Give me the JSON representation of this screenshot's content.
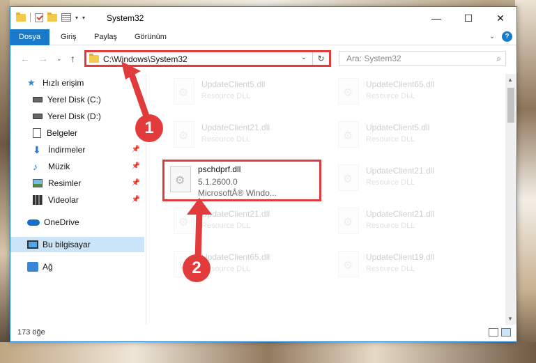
{
  "window": {
    "title": "System32"
  },
  "ribbon": {
    "tabs": [
      "Dosya",
      "Giriş",
      "Paylaş",
      "Görünüm"
    ],
    "help": "?"
  },
  "navigation": {
    "address": "C:\\Windows\\System32",
    "search_placeholder": "Ara: System32"
  },
  "sidebar": {
    "items": [
      {
        "label": "Hızlı erişim",
        "icon": "star-icon"
      },
      {
        "label": "Yerel Disk (C:)",
        "icon": "disk-icon"
      },
      {
        "label": "Yerel Disk (D:)",
        "icon": "disk-icon"
      },
      {
        "label": "Belgeler",
        "icon": "documents-icon"
      },
      {
        "label": "İndirmeler",
        "icon": "downloads-icon"
      },
      {
        "label": "Müzik",
        "icon": "music-icon"
      },
      {
        "label": "Resimler",
        "icon": "pictures-icon"
      },
      {
        "label": "Videolar",
        "icon": "videos-icon"
      },
      {
        "label": "OneDrive",
        "icon": "onedrive-icon"
      },
      {
        "label": "Bu bilgisayar",
        "icon": "this-pc-icon"
      },
      {
        "label": "Ağ",
        "icon": "network-icon"
      }
    ]
  },
  "files": {
    "highlighted": {
      "name": "pschdprf.dll",
      "version": "5.1.2600.0",
      "company": "MicrosoftÂ® Windo..."
    },
    "tiles": [
      {
        "name": "UpdateClient5.dll",
        "type": "Resource DLL"
      },
      {
        "name": "UpdateClient65.dll",
        "type": "Resource DLL"
      },
      {
        "name": "UpdateClient21.dll",
        "type": "Resource DLL"
      },
      {
        "name": "UpdateClient5.dll",
        "type": "Resource DLL"
      },
      {
        "name": "UpdateClient21.dll",
        "type": "Resource DLL"
      },
      {
        "name": "UpdateClient21.dll",
        "type": "Resource DLL"
      },
      {
        "name": "UpdateClient21.dll",
        "type": "Resource DLL"
      },
      {
        "name": "UpdateClient65.dll",
        "type": "Resource DLL"
      },
      {
        "name": "UpdateClient19.dll",
        "type": "Resource DLL"
      }
    ]
  },
  "status": {
    "count": "173 öğe"
  },
  "annotations": {
    "step1": "1",
    "step2": "2"
  },
  "colors": {
    "accent": "#1979ca",
    "highlight": "#e23b3b"
  }
}
